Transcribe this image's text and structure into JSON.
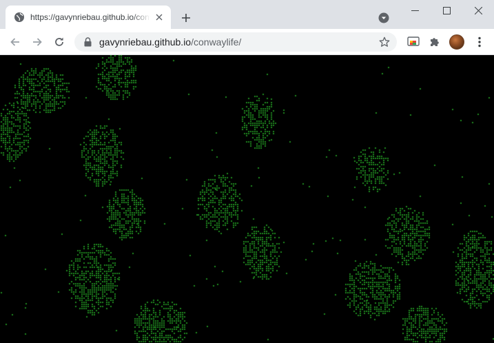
{
  "browser": {
    "tab": {
      "title": "https://gavynriebau.github.io/conwaylife/",
      "favicon": "globe-icon"
    },
    "address_bar": {
      "domain": "gavynriebau.github.io",
      "path": "/conwaylife/"
    },
    "icons": {
      "back": "arrow-left-icon",
      "forward": "arrow-right-icon",
      "reload": "reload-icon",
      "lock": "lock-icon",
      "bookmark": "star-icon",
      "extension_cast": "cast-extension-icon",
      "extensions": "puzzle-icon",
      "menu": "three-dots-icon",
      "new_tab": "plus-icon",
      "minimize": "minimize-icon",
      "maximize": "maximize-icon",
      "close": "close-icon"
    }
  },
  "page": {
    "background": "#000000",
    "cell_color": "#1f8a1f"
  }
}
